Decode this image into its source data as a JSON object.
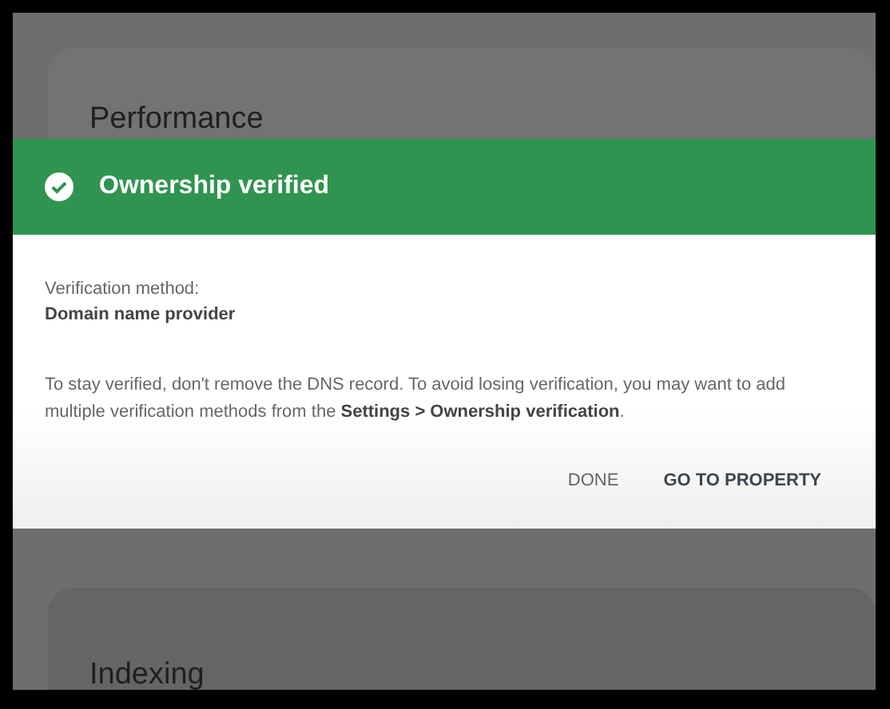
{
  "background_cards": [
    {
      "title": "Performance"
    },
    {
      "title": "Indexing"
    }
  ],
  "dialog": {
    "title": "Ownership verified",
    "method_label": "Verification method:",
    "method_value": "Domain name provider",
    "message": "To stay verified, don't remove the DNS record. To avoid losing verification, you may want to add multiple verification methods from the **Settings > Ownership verification**.",
    "buttons": [
      "DONE",
      "GO TO PROPERTY"
    ]
  }
}
